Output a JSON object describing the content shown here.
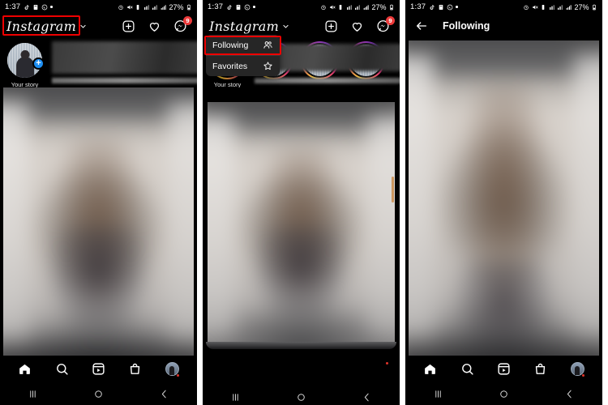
{
  "meta": {
    "app_name": "Instagram",
    "screenshot_panels": 3,
    "accent_red": "#ef0000",
    "badge_red": "#ec3a3a",
    "plus_blue": "#1d8ef2",
    "menu_bg": "#262626"
  },
  "status_bar": {
    "time": "1:37",
    "battery": "27%",
    "left_icons": [
      "tiktok-icon",
      "app-icon",
      "whatsapp-icon",
      "dot-icon"
    ],
    "right_icons": [
      "alarm-icon",
      "mute-icon",
      "vibrate-icon",
      "signal-1-icon",
      "signal-2-icon",
      "signal-bars-icon"
    ]
  },
  "panel1": {
    "header": {
      "logo": "Instagram",
      "dropdown_caret": "chevron-down-icon",
      "actions": [
        {
          "name": "create-icon",
          "label": "Create"
        },
        {
          "name": "activity-heart-icon",
          "label": "Activity"
        },
        {
          "name": "messenger-icon",
          "label": "Messenger",
          "badge": "9"
        }
      ]
    },
    "stories": {
      "your_story_label": "Your story",
      "add_badge": "+"
    },
    "annotation": "Instagram title with dropdown caret highlighted"
  },
  "panel2": {
    "header": {
      "logo": "Instagram",
      "dropdown_caret": "chevron-down-icon",
      "actions": [
        {
          "name": "create-icon",
          "label": "Create"
        },
        {
          "name": "activity-heart-icon",
          "label": "Activity"
        },
        {
          "name": "messenger-icon",
          "label": "Messenger",
          "badge": "9"
        }
      ]
    },
    "menu": {
      "items": [
        {
          "label": "Following",
          "icon": "people-icon",
          "highlighted": true
        },
        {
          "label": "Favorites",
          "icon": "star-icon",
          "highlighted": false
        }
      ]
    },
    "stories": {
      "your_story_label": "Your story"
    },
    "annotation": "Following menu item highlighted"
  },
  "panel3": {
    "header": {
      "back_icon": "back-arrow-icon",
      "title": "Following"
    }
  },
  "tab_bar": {
    "items": [
      {
        "name": "tab-home",
        "icon": "home-icon",
        "label": "Home",
        "active": true
      },
      {
        "name": "tab-search",
        "icon": "search-icon",
        "label": "Search",
        "active": false
      },
      {
        "name": "tab-reels",
        "icon": "reels-icon",
        "label": "Reels",
        "active": false
      },
      {
        "name": "tab-shop",
        "icon": "shop-bag-icon",
        "label": "Shop",
        "active": false
      },
      {
        "name": "tab-profile",
        "icon": "profile-avatar-icon",
        "label": "Profile",
        "active": false
      }
    ]
  },
  "system_nav": {
    "items": [
      {
        "name": "recents-button",
        "icon": "recents-icon"
      },
      {
        "name": "home-button",
        "icon": "circle-icon"
      },
      {
        "name": "back-button",
        "icon": "chevron-left-icon"
      }
    ]
  }
}
